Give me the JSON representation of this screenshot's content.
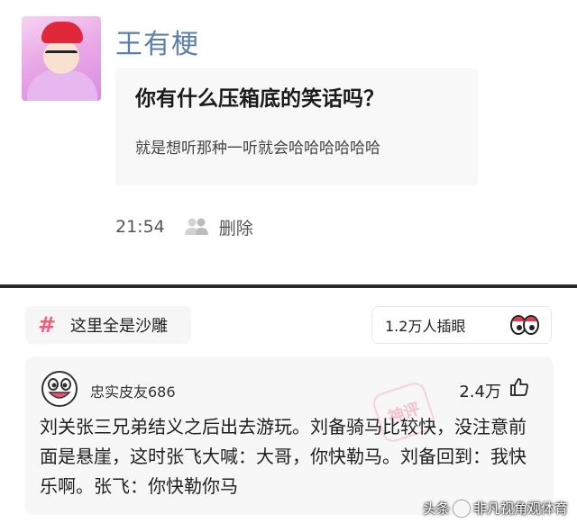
{
  "post": {
    "username": "王有梗",
    "question": "你有什么压箱底的笑话吗？",
    "subtext": "就是想听那种一听就会哈哈哈哈哈哈",
    "time": "21:54",
    "delete_label": "删除"
  },
  "topic": {
    "label": "这里全是沙雕",
    "views": "1.2万人插眼"
  },
  "comment": {
    "username": "忠实皮友686",
    "likes": "2.4万",
    "stamp": "神评",
    "text": "刘关张三兄弟结义之后出去游玩。刘备骑马比较快，没注意前面是悬崖，这时张飞大喊：大哥，你快勒马。刘备回到：我快乐啊。张飞：你快勒你马"
  },
  "watermark": {
    "prefix": "头条",
    "name": "非凡视角观体育"
  },
  "colors": {
    "username": "#5b7faa",
    "hash": "#ef5e7d"
  }
}
